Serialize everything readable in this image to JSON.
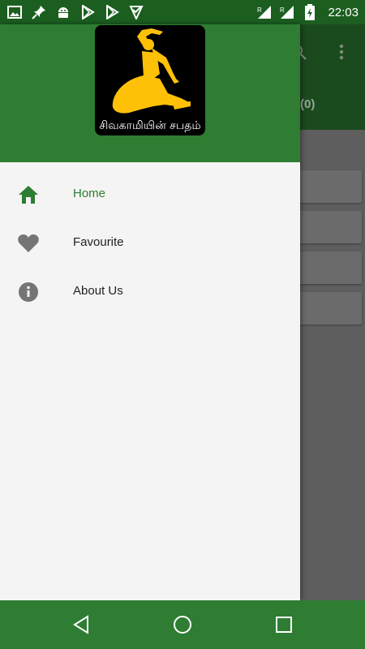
{
  "status_bar": {
    "time": "22:03",
    "left_icons": [
      "gallery-icon",
      "pin-icon",
      "android-icon",
      "play-store-icon",
      "play-store-icon",
      "check-shield-icon"
    ],
    "right_icons": [
      "signal-r-icon",
      "signal-r-icon",
      "battery-charging-icon"
    ]
  },
  "background_app": {
    "toolbar_icons": [
      "search-icon",
      "more-vert-icon"
    ],
    "tab_text": "(0)"
  },
  "drawer": {
    "header": {
      "logo_text": "சிவகாமியின் சபதம்",
      "logo_colors": {
        "background": "#000000",
        "figure": "#ffc107",
        "text": "#ffffff"
      }
    },
    "items": [
      {
        "label": "Home",
        "icon": "home-icon",
        "active": true
      },
      {
        "label": "Favourite",
        "icon": "heart-icon",
        "active": false
      },
      {
        "label": "About Us",
        "icon": "info-icon",
        "active": false
      }
    ]
  },
  "nav_bar": {
    "buttons": [
      "back-icon",
      "home-circle-icon",
      "recents-icon"
    ]
  },
  "colors": {
    "primary": "#2e7d32",
    "primary_dark": "#1b5e20",
    "drawer_bg": "#f4f4f4",
    "inactive_icon": "#757575"
  }
}
